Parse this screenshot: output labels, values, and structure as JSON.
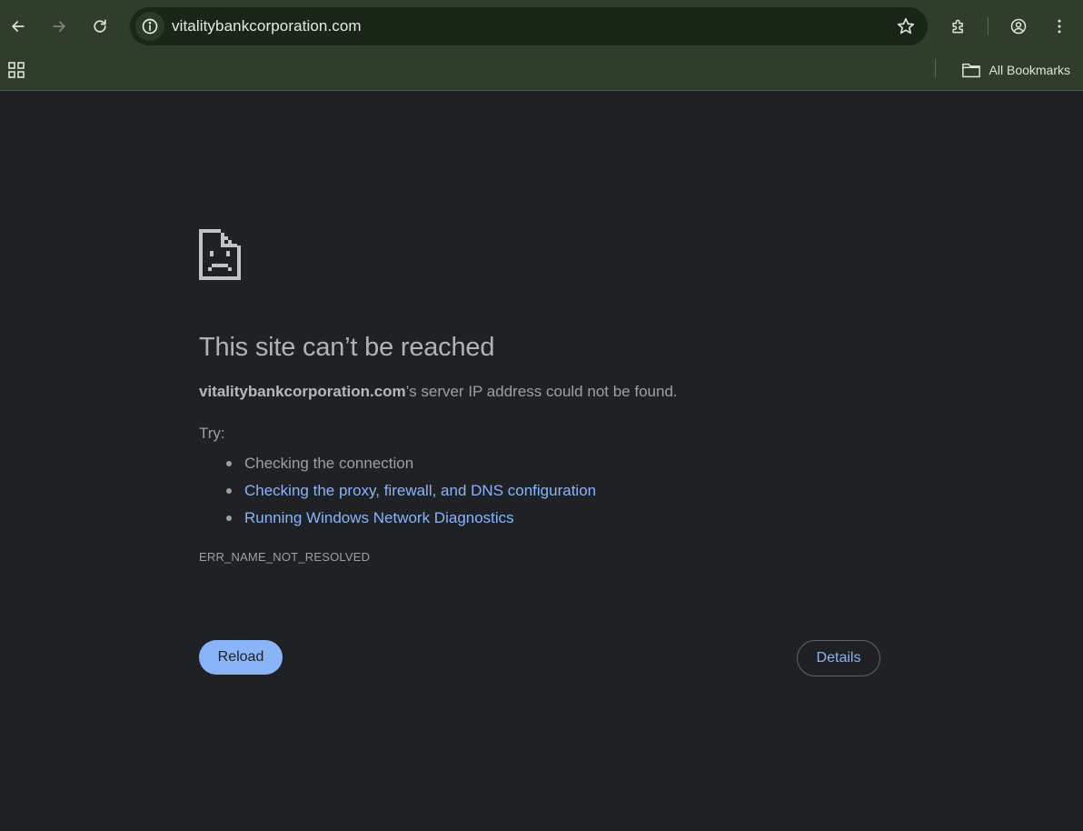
{
  "browser": {
    "url": "vitalitybankcorporation.com",
    "bookmarks_label": "All Bookmarks",
    "icons": [
      "back-icon",
      "forward-icon",
      "reload-icon",
      "site-info-icon",
      "star-icon",
      "extensions-icon",
      "profile-icon",
      "more-menu-icon",
      "apps-icon",
      "folder-icon"
    ]
  },
  "error_page": {
    "title": "This site can’t be reached",
    "domain": "vitalitybankcorporation.com",
    "message_suffix": "’s server IP address could not be found.",
    "try_label": "Try:",
    "suggestions": [
      {
        "text": "Checking the connection",
        "is_link": false
      },
      {
        "text": "Checking the proxy, firewall, and DNS configuration",
        "is_link": true
      },
      {
        "text": "Running Windows Network Diagnostics",
        "is_link": true
      }
    ],
    "error_code": "ERR_NAME_NOT_RESOLVED",
    "reload_label": "Reload",
    "details_label": "Details"
  },
  "colors": {
    "toolbar": "#2f3d2a",
    "omnibox": "#1a2618",
    "page_background": "#202124",
    "link": "#8ab4f8",
    "primary_button": "#8ab4f8"
  }
}
